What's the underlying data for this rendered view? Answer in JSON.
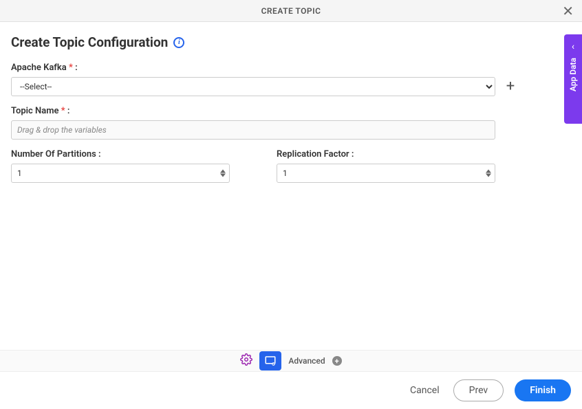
{
  "header": {
    "title": "CREATE TOPIC"
  },
  "page": {
    "title": "Create Topic Configuration"
  },
  "fields": {
    "kafka": {
      "label": "Apache Kafka",
      "required": "*",
      "colon": ":",
      "selected": "--Select--"
    },
    "topicName": {
      "label": "Topic Name",
      "required": "*",
      "colon": ":",
      "placeholder": "Drag & drop the variables",
      "value": ""
    },
    "partitions": {
      "label": "Number Of Partitions :",
      "value": "1"
    },
    "replication": {
      "label": "Replication Factor :",
      "value": "1"
    }
  },
  "toolbar": {
    "advanced": "Advanced"
  },
  "footer": {
    "cancel": "Cancel",
    "prev": "Prev",
    "finish": "Finish"
  },
  "sideTab": {
    "label": "App Data"
  }
}
